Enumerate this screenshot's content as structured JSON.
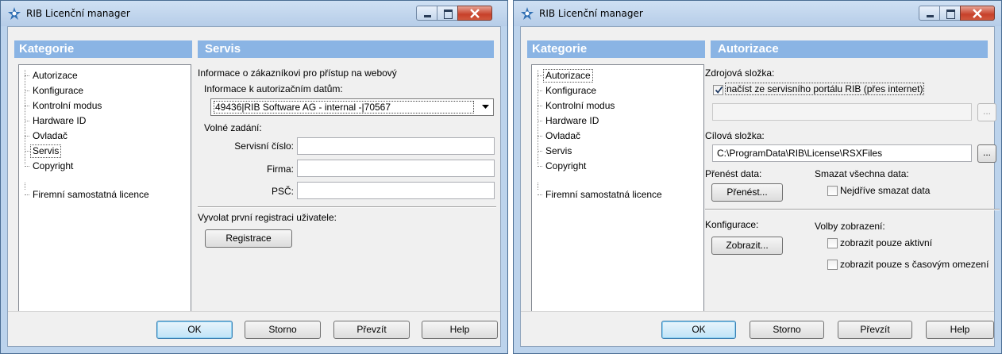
{
  "left": {
    "title": "RIB Licenční manager",
    "categories_header": "Kategorie",
    "section_header": "Servis",
    "tree": [
      "Autorizace",
      "Konfigurace",
      "Kontrolní modus",
      "Hardware ID",
      "Ovladač",
      "Servis",
      "Copyright"
    ],
    "tree_license": "Firemní samostatná licence",
    "info_text": "Informace o zákazníkovi pro přístup na webový",
    "auth_label": "Informace k autorizačním datům:",
    "auth_value": "49436|RIB Software AG - internal -|70567",
    "free_input_label": "Volné zadání:",
    "service_number_label": "Servisní číslo:",
    "service_number_value": "",
    "company_label": "Firma:",
    "company_value": "",
    "zip_label": "PSČ:",
    "zip_value": "",
    "first_registration_label": "Vyvolat první registraci uživatele:",
    "register_button": "Registrace",
    "buttons": {
      "ok": "OK",
      "cancel": "Storno",
      "apply": "Převzít",
      "help": "Help"
    }
  },
  "right": {
    "title": "RIB Licenční manager",
    "categories_header": "Kategorie",
    "section_header": "Autorizace",
    "tree": [
      "Autorizace",
      "Konfigurace",
      "Kontrolní modus",
      "Hardware ID",
      "Ovladač",
      "Servis",
      "Copyright"
    ],
    "tree_license": "Firemní samostatná licence",
    "source_folder_label": "Zdrojová složka:",
    "load_from_portal_label": "načíst ze servisního portálu RIB (přes internet)",
    "load_from_portal_checked": true,
    "source_path": "",
    "browse_label": "...",
    "target_folder_label": "Cílová složka:",
    "target_path": "C:\\ProgramData\\RIB\\License\\RSXFiles",
    "transfer_data_label": "Přenést data:",
    "transfer_button": "Přenést...",
    "delete_all_label": "Smazat všechna data:",
    "delete_first_label": "Nejdříve smazat data",
    "configuration_label": "Konfigurace:",
    "show_button": "Zobrazit...",
    "display_options_label": "Volby zobrazení:",
    "show_active_label": "zobrazit pouze aktivní",
    "show_time_limited_label": "zobrazit pouze s časovým omezení",
    "buttons": {
      "ok": "OK",
      "cancel": "Storno",
      "apply": "Převzít",
      "help": "Help"
    }
  },
  "colors": {
    "header_blue": "#8ab4e4",
    "frame_blue": "#bcd3ec",
    "close_red": "#c7412a"
  }
}
